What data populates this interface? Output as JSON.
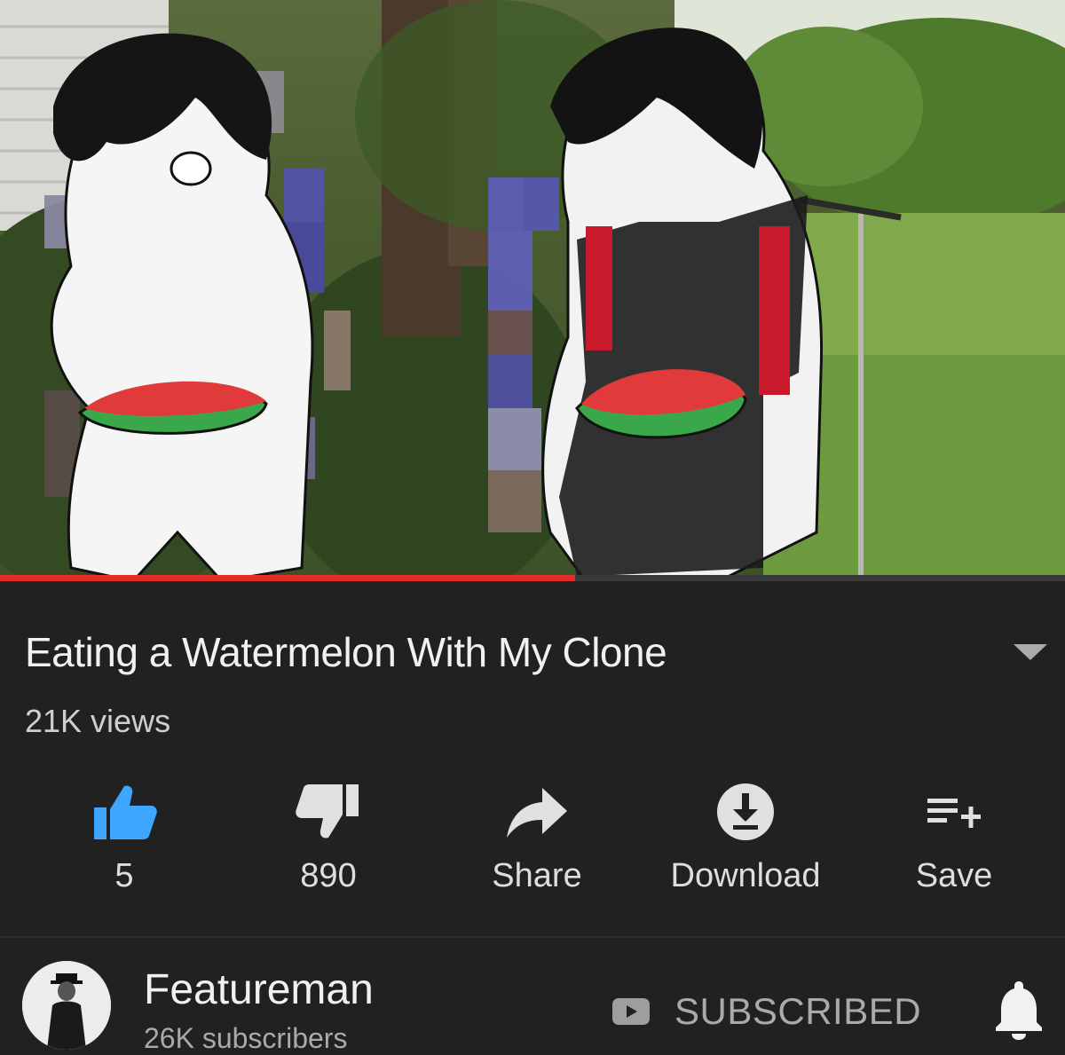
{
  "video": {
    "progress_fraction": 0.54
  },
  "info": {
    "title": "Eating a Watermelon With My Clone",
    "views": "21K views"
  },
  "actions": [
    {
      "icon": "thumbs-up-icon",
      "label": "5",
      "color": "#3ea6ff"
    },
    {
      "icon": "thumbs-down-icon",
      "label": "890",
      "color": "#e0e0e0"
    },
    {
      "icon": "share-icon",
      "label": "Share",
      "color": "#e0e0e0"
    },
    {
      "icon": "download-icon",
      "label": "Download",
      "color": "#e0e0e0"
    },
    {
      "icon": "add-to-playlist-icon",
      "label": "Save",
      "color": "#e0e0e0"
    }
  ],
  "channel": {
    "name": "Featureman",
    "subscribers": "26K subscribers",
    "subscribe_label": "SUBSCRIBED"
  },
  "colors": {
    "background": "#212121",
    "progress": "#e52d27",
    "like_active": "#3ea6ff"
  }
}
